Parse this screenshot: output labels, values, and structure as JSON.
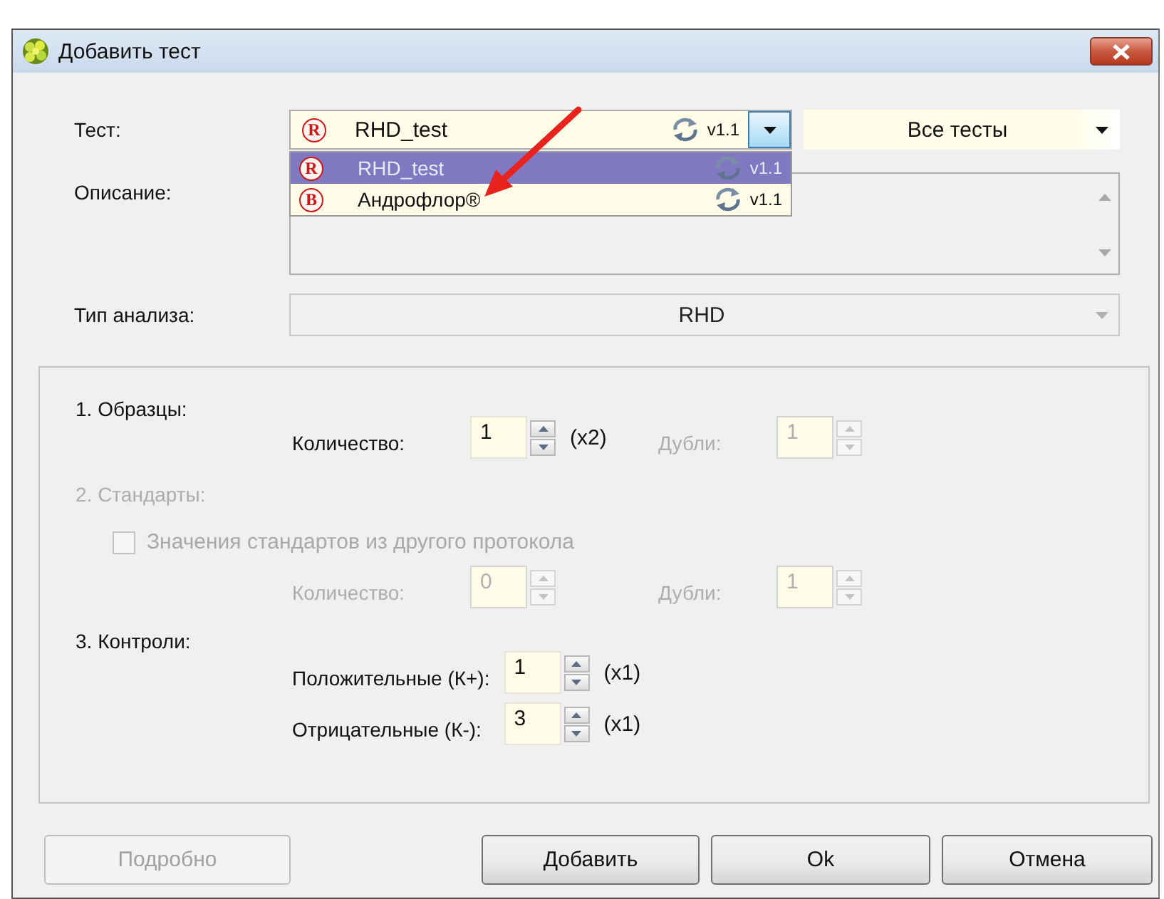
{
  "window": {
    "title": "Добавить тест"
  },
  "test": {
    "label": "Тест:",
    "badge": "R",
    "name": "RHD_test",
    "version": "v1.1",
    "filter": "Все тесты",
    "dropdown": {
      "expanded": true,
      "items": [
        {
          "badge": "R",
          "name": "RHD_test",
          "version": "v1.1",
          "selected": true
        },
        {
          "badge": "B",
          "name": "Андрофлор®",
          "version": "v1.1",
          "selected": false
        }
      ]
    }
  },
  "description": {
    "label": "Описание:"
  },
  "analysis_type": {
    "label": "Тип анализа:",
    "value": "RHD",
    "disabled": true
  },
  "groups": [
    {
      "title": "1. Образцы:",
      "disabled": false,
      "rows": [
        {
          "fields": [
            {
              "label": "Количество:",
              "value": "1",
              "suffix": "(x2)",
              "disabled": false
            },
            {
              "label": "Дубли:",
              "value": "1",
              "disabled": true
            }
          ]
        }
      ]
    },
    {
      "title": "2. Стандарты:",
      "disabled": true,
      "checkbox": {
        "label": "Значения стандартов из другого протокола",
        "checked": false,
        "disabled": true
      },
      "rows": [
        {
          "fields": [
            {
              "label": "Количество:",
              "value": "0",
              "disabled": true
            },
            {
              "label": "Дубли:",
              "value": "1",
              "disabled": true
            }
          ]
        }
      ]
    },
    {
      "title": "3. Контроли:",
      "disabled": false,
      "rows": [
        {
          "fields": [
            {
              "label": "Положительные (К+):",
              "value": "1",
              "suffix": "(x1)",
              "disabled": false
            }
          ]
        },
        {
          "fields": [
            {
              "label": "Отрицательные (К-):",
              "value": "3",
              "suffix": "(x1)",
              "disabled": false
            }
          ]
        }
      ]
    }
  ],
  "buttons": [
    {
      "label": "Подробно",
      "disabled": true
    },
    {
      "label": "Добавить",
      "disabled": false
    },
    {
      "label": "Ok",
      "disabled": false
    },
    {
      "label": "Отмена",
      "disabled": false
    }
  ]
}
